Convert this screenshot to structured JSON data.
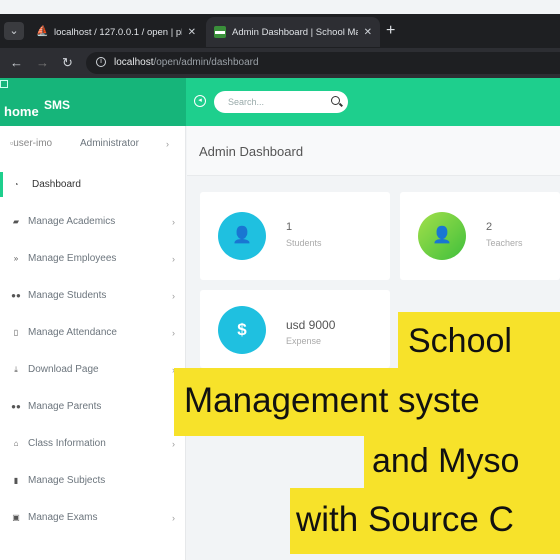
{
  "browser": {
    "tabs": [
      {
        "label": "localhost / 127.0.0.1 / open | ph",
        "icon": "phpmyadmin-icon"
      },
      {
        "label": "Admin Dashboard | School Man",
        "icon": "sms-favicon-icon"
      }
    ],
    "url_host": "localhost",
    "url_path": "/open/admin/dashboard"
  },
  "header": {
    "brand_home": "home",
    "brand_sms": "SMS",
    "search_placeholder": "Search..."
  },
  "sidebar": {
    "user_img_alt": "user-imo",
    "user_role": "Administrator",
    "items": [
      {
        "label": "Dashboard",
        "icon": "dashboard-icon",
        "chevron": false,
        "active": true
      },
      {
        "label": "Manage Academics",
        "icon": "graduation-cap-icon",
        "chevron": true
      },
      {
        "label": "Manage Employees",
        "icon": "employees-icon",
        "chevron": true
      },
      {
        "label": "Manage Students",
        "icon": "users-icon",
        "chevron": true
      },
      {
        "label": "Manage Attendance",
        "icon": "clipboard-icon",
        "chevron": true
      },
      {
        "label": "Download Page",
        "icon": "download-icon",
        "chevron": true
      },
      {
        "label": "Manage Parents",
        "icon": "users-icon",
        "chevron": false
      },
      {
        "label": "Class Information",
        "icon": "building-icon",
        "chevron": true
      },
      {
        "label": "Manage Subjects",
        "icon": "book-icon",
        "chevron": false
      },
      {
        "label": "Manage Exams",
        "icon": "exam-icon",
        "chevron": true
      }
    ]
  },
  "main": {
    "title": "Admin Dashboard",
    "cards": [
      {
        "value": "1",
        "label": "Students",
        "icon": "user-icon",
        "color": "#1fc0e0"
      },
      {
        "value": "2",
        "label": "Teachers",
        "icon": "user-icon",
        "color": "#5cc93f"
      },
      {
        "value": "usd 9000",
        "label": "Expense",
        "icon": "dollar-icon",
        "color": "#1fc0e0"
      }
    ]
  },
  "overlay": {
    "lines": [
      "School",
      "Management  syste",
      "and Myso",
      "with Source C"
    ]
  }
}
